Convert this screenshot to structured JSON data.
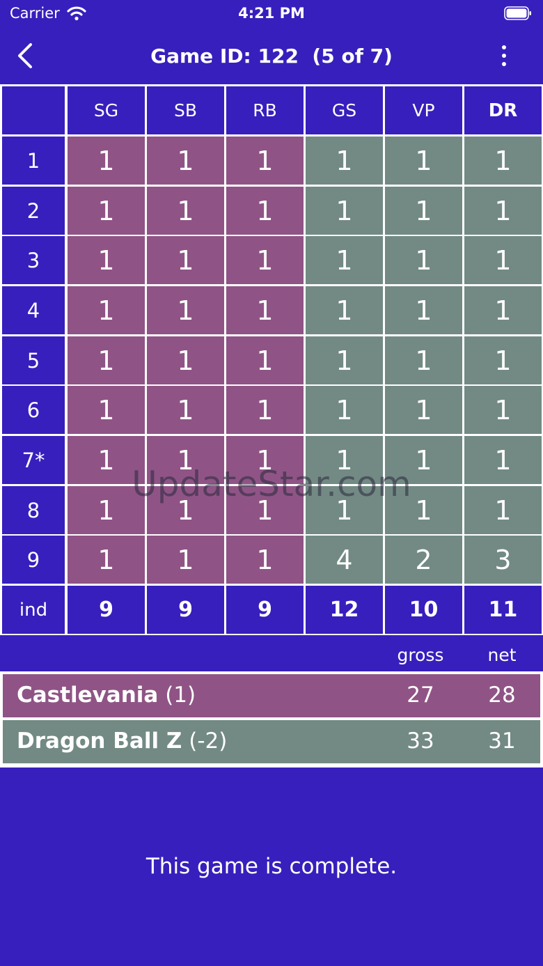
{
  "status_bar": {
    "carrier": "Carrier",
    "time": "4:21 PM"
  },
  "nav": {
    "title": "Game ID: 122  (5 of 7)"
  },
  "grid": {
    "columns": [
      "SG",
      "SB",
      "RB",
      "GS",
      "VP",
      "DR"
    ],
    "rows": [
      {
        "label": "1",
        "scores": [
          "1",
          "1",
          "1",
          "1",
          "1",
          "1"
        ]
      },
      {
        "label": "2",
        "scores": [
          "1",
          "1",
          "1",
          "1",
          "1",
          "1"
        ]
      },
      {
        "label": "3",
        "scores": [
          "1",
          "1",
          "1",
          "1",
          "1",
          "1"
        ]
      },
      {
        "label": "4",
        "scores": [
          "1",
          "1",
          "1",
          "1",
          "1",
          "1"
        ]
      },
      {
        "label": "5",
        "scores": [
          "1",
          "1",
          "1",
          "1",
          "1",
          "1"
        ]
      },
      {
        "label": "6",
        "scores": [
          "1",
          "1",
          "1",
          "1",
          "1",
          "1"
        ]
      },
      {
        "label": "7*",
        "scores": [
          "1",
          "1",
          "1",
          "1",
          "1",
          "1"
        ]
      },
      {
        "label": "8",
        "scores": [
          "1",
          "1",
          "1",
          "1",
          "1",
          "1"
        ]
      },
      {
        "label": "9",
        "scores": [
          "1",
          "1",
          "1",
          "4",
          "2",
          "3"
        ]
      }
    ],
    "ind": {
      "label": "ind",
      "values": [
        "9",
        "9",
        "9",
        "12",
        "10",
        "11"
      ]
    }
  },
  "totals": {
    "gross_label": "gross",
    "net_label": "net",
    "teams": [
      {
        "name": "Castlevania",
        "handicap": "(1)",
        "gross": "27",
        "net": "28",
        "color": "#8f5485"
      },
      {
        "name": "Dragon Ball Z",
        "handicap": "(-2)",
        "gross": "33",
        "net": "31",
        "color": "#738a84"
      }
    ]
  },
  "message": "This game is complete.",
  "watermark": "UpdateStar.com",
  "colors": {
    "background": "#371fbd",
    "team1": "#8f5485",
    "team2": "#738a84"
  }
}
